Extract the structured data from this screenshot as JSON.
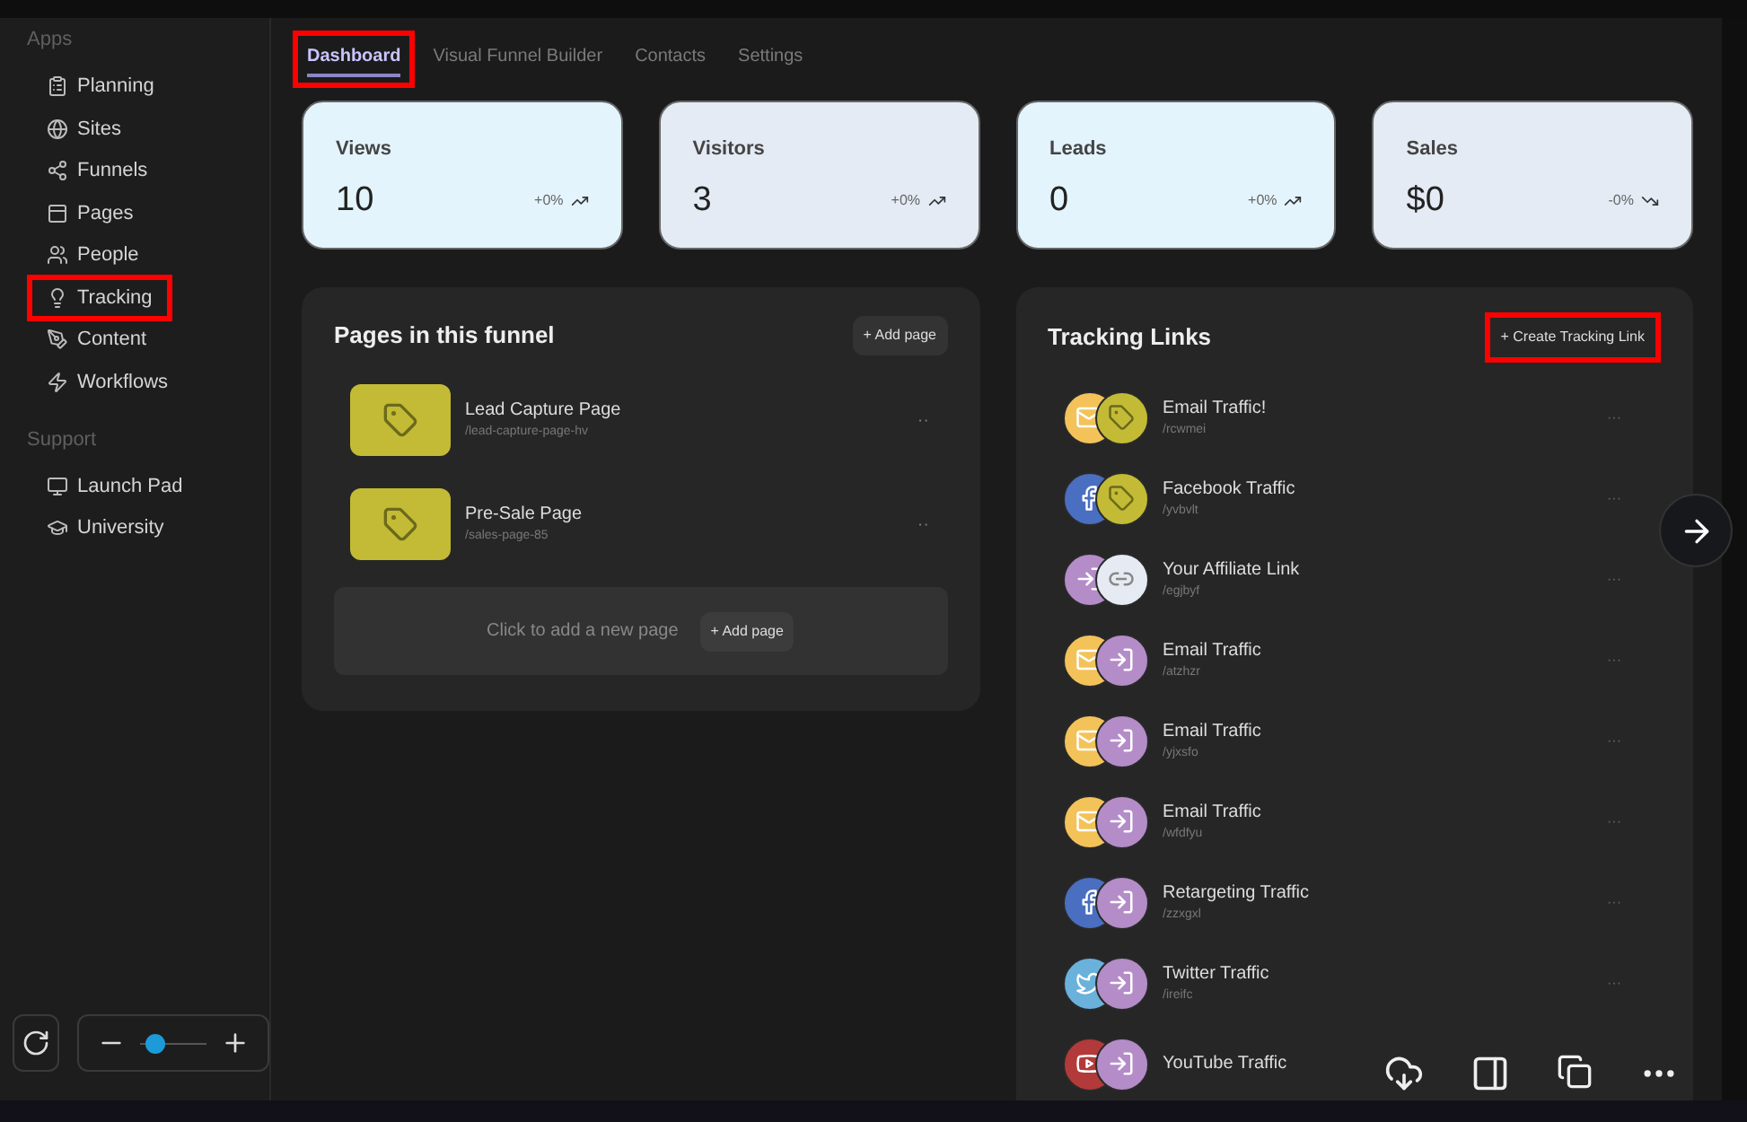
{
  "sidebar": {
    "sections": [
      {
        "title": "Apps",
        "items": [
          {
            "label": "Planning",
            "highlighted": false
          },
          {
            "label": "Sites",
            "highlighted": false
          },
          {
            "label": "Funnels",
            "highlighted": false
          },
          {
            "label": "Pages",
            "highlighted": false
          },
          {
            "label": "People",
            "highlighted": false
          },
          {
            "label": "Tracking",
            "highlighted": true
          },
          {
            "label": "Content",
            "highlighted": false
          },
          {
            "label": "Workflows",
            "highlighted": false
          }
        ]
      },
      {
        "title": "Support",
        "items": [
          {
            "label": "Launch Pad",
            "highlighted": false
          },
          {
            "label": "University",
            "highlighted": false
          }
        ]
      }
    ]
  },
  "tabs": [
    {
      "label": "Dashboard",
      "selected": true,
      "highlighted": true
    },
    {
      "label": "Visual Funnel Builder",
      "selected": false,
      "highlighted": false
    },
    {
      "label": "Contacts",
      "selected": false,
      "highlighted": false
    },
    {
      "label": "Settings",
      "selected": false,
      "highlighted": false
    }
  ],
  "stats": [
    {
      "label": "Views",
      "value": "10",
      "change": "+0%",
      "kind": "up",
      "color": "#e3f4fd"
    },
    {
      "label": "Visitors",
      "value": "3",
      "change": "+0%",
      "kind": "up",
      "color": "#e4ebf5"
    },
    {
      "label": "Leads",
      "value": "0",
      "change": "+0%",
      "kind": "up",
      "color": "#e3f4fd"
    },
    {
      "label": "Sales",
      "value": "$0",
      "change": "-0%",
      "kind": "down",
      "color": "#e4ebf5"
    }
  ],
  "pages_panel": {
    "title": "Pages in this funnel",
    "add_button": "+ Add page",
    "pages": [
      {
        "name": "Lead Capture Page",
        "path": "/lead-capture-page-hv",
        "menu": "··"
      },
      {
        "name": "Pre-Sale Page",
        "path": "/sales-page-85",
        "menu": "··"
      }
    ],
    "empty_hint": "Click to add a new page",
    "empty_button": "+ Add page"
  },
  "tracking_panel": {
    "title": "Tracking Links",
    "create_button": "+ Create Tracking Link",
    "create_highlighted": true,
    "links": [
      {
        "name": "Email Traffic!",
        "path": "/rcwmei",
        "icons": [
          {
            "kind": "email"
          },
          {
            "kind": "tag"
          }
        ],
        "menu": "···"
      },
      {
        "name": "Facebook Traffic",
        "path": "/yvbvlt",
        "icons": [
          {
            "kind": "facebook"
          },
          {
            "kind": "tag"
          }
        ],
        "menu": "···"
      },
      {
        "name": "Your Affiliate Link",
        "path": "/egjbyf",
        "icons": [
          {
            "kind": "import"
          },
          {
            "kind": "link"
          }
        ],
        "menu": "···"
      },
      {
        "name": "Email Traffic",
        "path": "/atzhzr",
        "icons": [
          {
            "kind": "email"
          },
          {
            "kind": "import"
          }
        ],
        "menu": "···"
      },
      {
        "name": "Email Traffic",
        "path": "/yjxsfo",
        "icons": [
          {
            "kind": "email"
          },
          {
            "kind": "import"
          }
        ],
        "menu": "···"
      },
      {
        "name": "Email Traffic",
        "path": "/wfdfyu",
        "icons": [
          {
            "kind": "email"
          },
          {
            "kind": "import"
          }
        ],
        "menu": "···"
      },
      {
        "name": "Retargeting Traffic",
        "path": "/zzxgxl",
        "icons": [
          {
            "kind": "facebook"
          },
          {
            "kind": "import"
          }
        ],
        "menu": "···"
      },
      {
        "name": "Twitter Traffic",
        "path": "/ireifc",
        "icons": [
          {
            "kind": "twitter"
          },
          {
            "kind": "import"
          }
        ],
        "menu": "···"
      },
      {
        "name": "YouTube Traffic",
        "icons": [
          {
            "kind": "youtube"
          },
          {
            "kind": "import"
          }
        ]
      }
    ]
  },
  "viewer": {
    "zoom": {
      "level": 0.1
    }
  }
}
